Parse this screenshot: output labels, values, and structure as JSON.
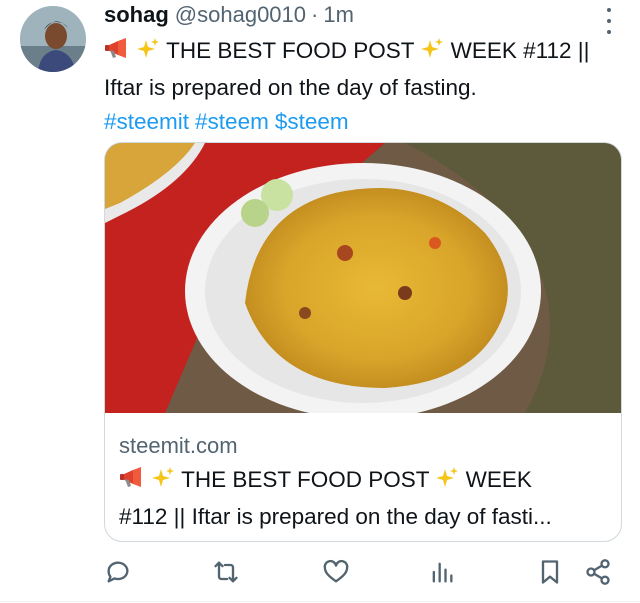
{
  "post": {
    "name": "sohag",
    "handle": "@sohag0010",
    "separator": "·",
    "time": "1m",
    "line1": "THE BEST FOOD POST",
    "line1_suffix": "WEEK #112 ||",
    "line2": "Iftar is prepared on the day of fasting.",
    "tags": [
      "#steemit",
      "#steem",
      "$steem"
    ]
  },
  "card": {
    "domain": "steemit.com",
    "title_part1": "THE BEST FOOD POST",
    "title_part2": "WEEK",
    "title_line2": "#112 || Iftar is prepared on the day of fasti..."
  },
  "icons": {
    "more": "more-dots-icon",
    "megaphone": "megaphone-icon",
    "sparkles": "sparkles-icon",
    "reply": "reply-icon",
    "repost": "repost-icon",
    "like": "like-icon",
    "views": "views-icon",
    "bookmark": "bookmark-icon",
    "share": "share-icon"
  },
  "colors": {
    "text": "#0f1419",
    "muted": "#536471",
    "link": "#1d9bf0",
    "border": "#cfd9de"
  }
}
